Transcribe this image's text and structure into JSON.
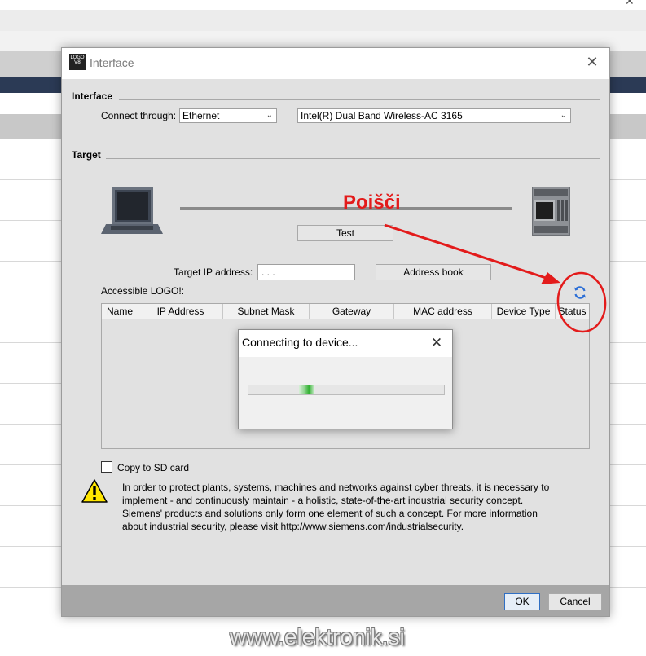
{
  "dialog": {
    "title": "Interface",
    "app_icon": "logo-v8-icon",
    "close_icon": "close-icon"
  },
  "interface_section": {
    "label": "Interface",
    "connect_label": "Connect through:",
    "connect_value": "Ethernet",
    "adapter_value": "Intel(R) Dual Band Wireless-AC 3165"
  },
  "target_section": {
    "label": "Target",
    "test_button": "Test",
    "target_ip_label": "Target IP address:",
    "target_ip_value": ".   .   .",
    "address_book_button": "Address book",
    "accessible_label": "Accessible LOGO!:",
    "refresh_icon": "refresh-icon"
  },
  "annotation": {
    "text": "Poišči",
    "color": "#e31b1b"
  },
  "table": {
    "columns": [
      "Name",
      "IP Address",
      "Subnet Mask",
      "Gateway",
      "MAC address",
      "Device Type",
      "Status"
    ],
    "rows": []
  },
  "popup": {
    "title": "Connecting to device...",
    "progress": 0.3
  },
  "copy_to_sd": {
    "label": "Copy to SD card",
    "checked": false
  },
  "security_notice": {
    "icon": "warning-icon",
    "text": "In order to protect plants, systems, machines and networks against cyber threats, it is necessary to\nimplement - and continuously maintain - a holistic, state-of-the-art industrial security concept.\nSiemens' products and solutions only form one element of such a concept. For more information\nabout industrial security, please visit http://www.siemens.com/industrialsecurity."
  },
  "footer": {
    "ok_button": "OK",
    "cancel_button": "Cancel"
  },
  "watermark": "www.elektronik.si",
  "colors": {
    "dialog_bg": "#e1e1e1",
    "footer_bg": "#a6a6a6",
    "annotation": "#e31b1b",
    "progress": "#2fb02f",
    "refresh": "#2d6fd6"
  }
}
